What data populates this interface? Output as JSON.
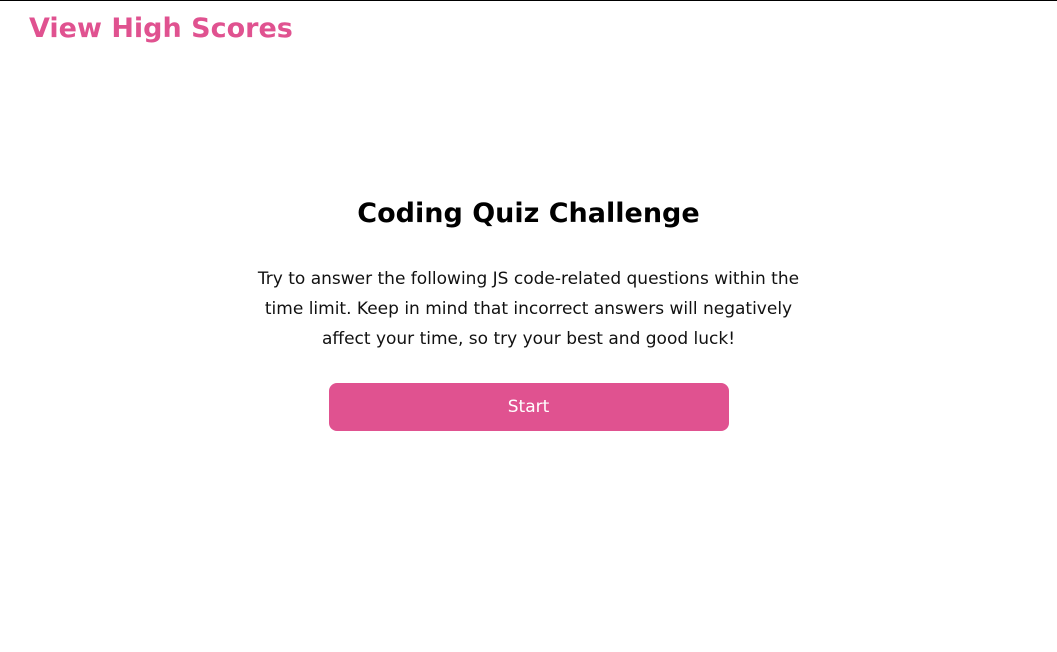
{
  "header": {
    "high_scores_label": "View High Scores"
  },
  "main": {
    "title": "Coding Quiz Challenge",
    "description": "Try to answer the following JS code-related questions within the time limit. Keep in mind that incorrect answers will negatively affect your time, so try your best and good luck!",
    "start_label": "Start"
  },
  "colors": {
    "accent": "#e05290",
    "text": "#111111",
    "background": "#ffffff"
  }
}
